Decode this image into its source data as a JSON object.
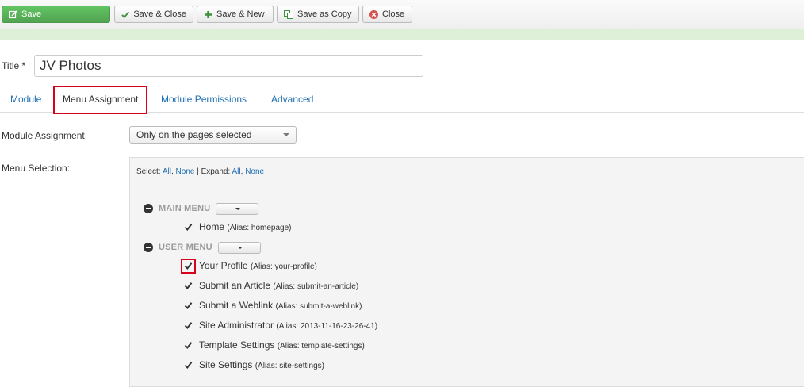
{
  "toolbar": {
    "save": "Save",
    "save_close": "Save & Close",
    "save_new": "Save & New",
    "save_copy": "Save as Copy",
    "close": "Close"
  },
  "title": {
    "label": "Title *",
    "value": "JV Photos"
  },
  "tabs": [
    {
      "label": "Module",
      "active": false
    },
    {
      "label": "Menu Assignment",
      "active": true
    },
    {
      "label": "Module Permissions",
      "active": false
    },
    {
      "label": "Advanced",
      "active": false
    }
  ],
  "module_assignment": {
    "label": "Module Assignment",
    "value": "Only on the pages selected"
  },
  "menu_selection": {
    "label": "Menu Selection:",
    "select_prefix": "Select:",
    "all": "All",
    "comma": ",",
    "none": "None",
    "divider": "|",
    "expand_prefix": "Expand:",
    "menus": [
      {
        "title": "MAIN MENU",
        "items": [
          {
            "label": "Home",
            "alias": "(Alias: homepage)",
            "checked": true
          }
        ]
      },
      {
        "title": "USER MENU",
        "items": [
          {
            "label": "Your Profile",
            "alias": "(Alias: your-profile)",
            "checked": true
          },
          {
            "label": "Submit an Article",
            "alias": "(Alias: submit-an-article)",
            "checked": true
          },
          {
            "label": "Submit a Weblink",
            "alias": "(Alias: submit-a-weblink)",
            "checked": true
          },
          {
            "label": "Site Administrator",
            "alias": "(Alias: 2013-11-16-23-26-41)",
            "checked": true
          },
          {
            "label": "Template Settings",
            "alias": "(Alias: template-settings)",
            "checked": true
          },
          {
            "label": "Site Settings",
            "alias": "(Alias: site-settings)",
            "checked": true
          }
        ]
      }
    ]
  },
  "colors": {
    "accent": "#1f6fb4",
    "save_green": "#51a351",
    "highlight": "#d9001b",
    "notice": "#dff0d8"
  }
}
